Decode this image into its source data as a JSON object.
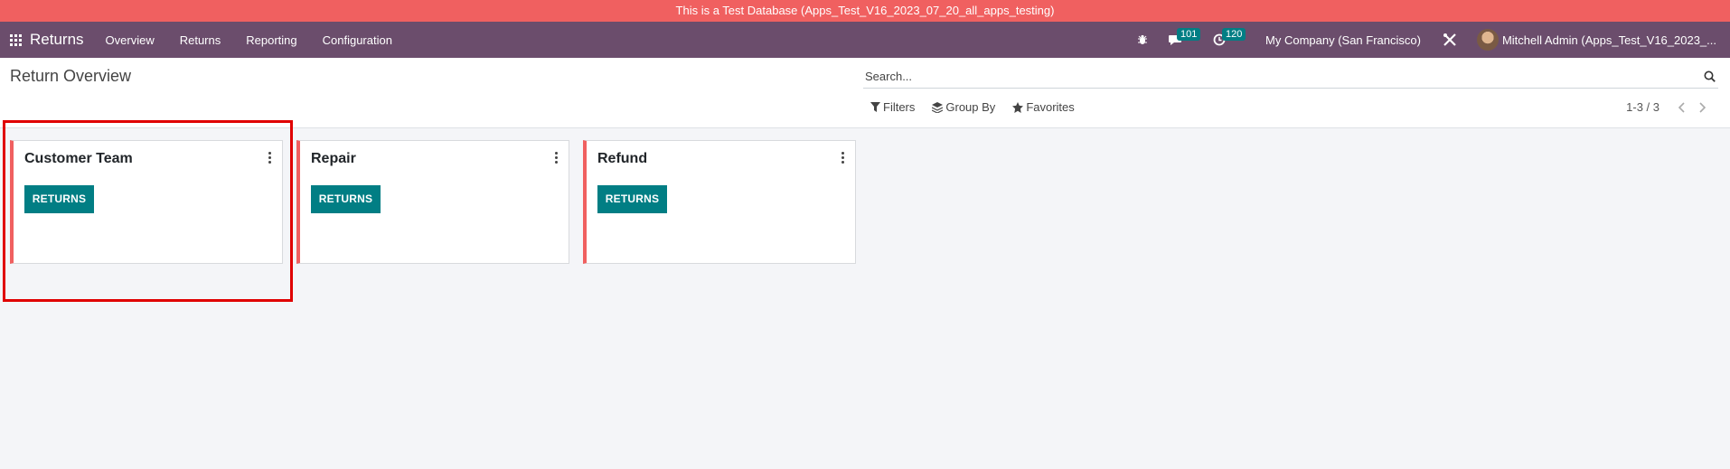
{
  "banner": {
    "text": "This is a Test Database (Apps_Test_V16_2023_07_20_all_apps_testing)"
  },
  "navbar": {
    "app_name": "Returns",
    "menu": [
      {
        "label": "Overview"
      },
      {
        "label": "Returns"
      },
      {
        "label": "Reporting"
      },
      {
        "label": "Configuration"
      }
    ],
    "messages_count": "101",
    "activities_count": "120",
    "company": "My Company (San Francisco)",
    "user": "Mitchell Admin (Apps_Test_V16_2023_..."
  },
  "control_panel": {
    "title": "Return Overview",
    "search_placeholder": "Search...",
    "filters_label": "Filters",
    "group_by_label": "Group By",
    "favorites_label": "Favorites",
    "pager": "1-3 / 3"
  },
  "cards": [
    {
      "title": "Customer Team",
      "button": "RETURNS"
    },
    {
      "title": "Repair",
      "button": "RETURNS"
    },
    {
      "title": "Refund",
      "button": "RETURNS"
    }
  ],
  "colors": {
    "banner": "#f06060",
    "navbar": "#6b4d6c",
    "accent": "#017e84",
    "card_stripe": "#f06060",
    "highlight": "#e00000"
  }
}
